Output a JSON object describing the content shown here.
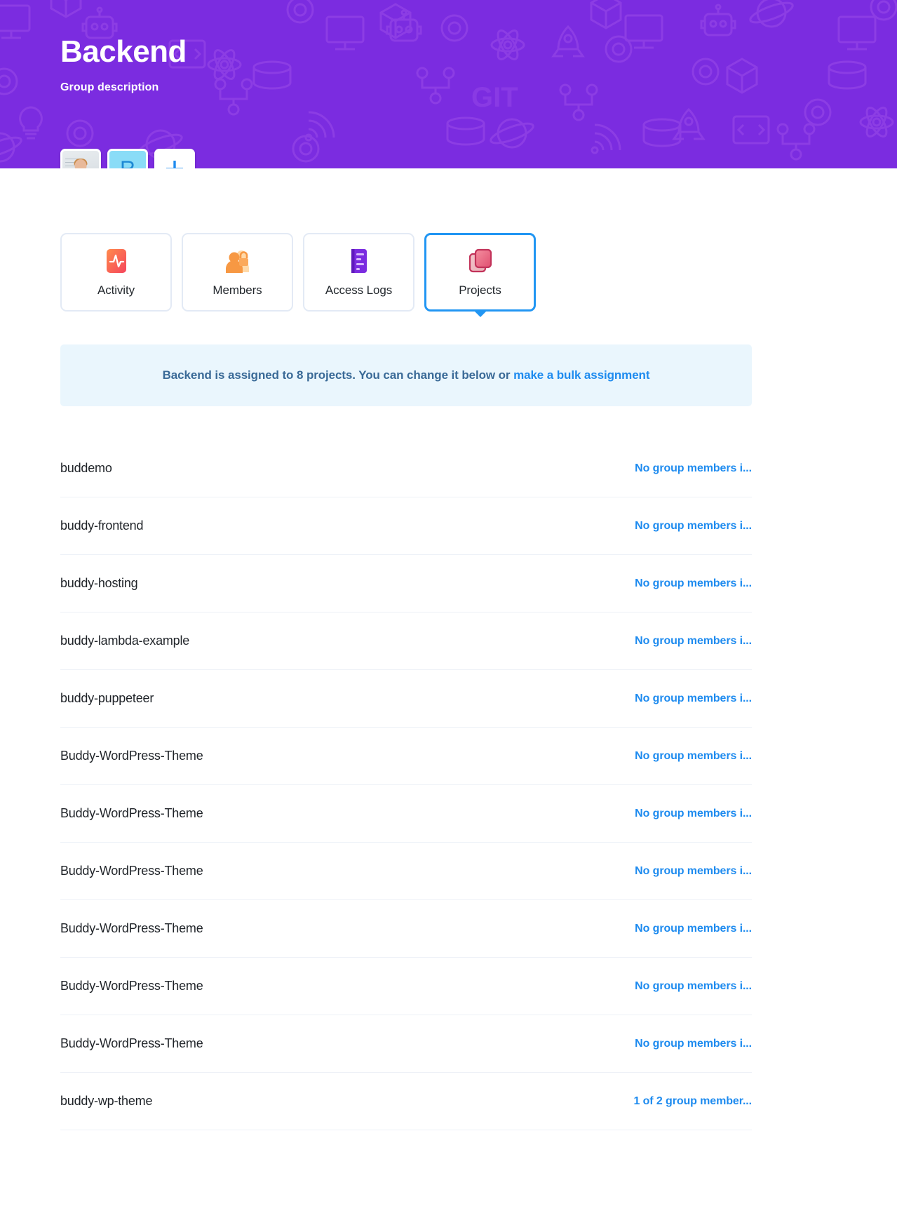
{
  "hero": {
    "title": "Backend",
    "subtitle": "Group description",
    "background_color": "#7B2CE0",
    "pattern_color": "#9B4BE8"
  },
  "members": {
    "avatars": [
      {
        "type": "photo",
        "name": "member-avatar-photo",
        "label": ""
      },
      {
        "type": "initial",
        "name": "member-avatar-initial",
        "label": "R",
        "bg": "#8ADCF7",
        "fg": "#1C88D4"
      },
      {
        "type": "add",
        "name": "add-member-button",
        "label": "+",
        "fg": "#1E8BEF"
      }
    ]
  },
  "tabs": [
    {
      "label": "Activity",
      "icon": "activity-icon",
      "active": false
    },
    {
      "label": "Members",
      "icon": "members-icon",
      "active": false
    },
    {
      "label": "Access Logs",
      "icon": "access-logs-icon",
      "active": false
    },
    {
      "label": "Projects",
      "icon": "projects-icon",
      "active": true
    }
  ],
  "banner": {
    "text_before": "Backend is assigned to 8 projects. You can change it below or ",
    "link_label": "make a bulk assignment",
    "background": "#EAF6FD",
    "text_color": "#3A6A97",
    "link_color": "#1E8BEF"
  },
  "projects": [
    {
      "name": "buddemo",
      "members": "No group members i..."
    },
    {
      "name": "buddy-frontend",
      "members": "No group members i..."
    },
    {
      "name": "buddy-hosting",
      "members": "No group members i..."
    },
    {
      "name": "buddy-lambda-example",
      "members": "No group members i..."
    },
    {
      "name": "buddy-puppeteer",
      "members": "No group members i..."
    },
    {
      "name": "Buddy-WordPress-Theme",
      "members": "No group members i..."
    },
    {
      "name": "Buddy-WordPress-Theme",
      "members": "No group members i..."
    },
    {
      "name": "Buddy-WordPress-Theme",
      "members": "No group members i..."
    },
    {
      "name": "Buddy-WordPress-Theme",
      "members": "No group members i..."
    },
    {
      "name": "Buddy-WordPress-Theme",
      "members": "No group members i..."
    },
    {
      "name": "Buddy-WordPress-Theme",
      "members": "No group members i..."
    },
    {
      "name": "buddy-wp-theme",
      "members": "1 of 2 group member..."
    }
  ]
}
